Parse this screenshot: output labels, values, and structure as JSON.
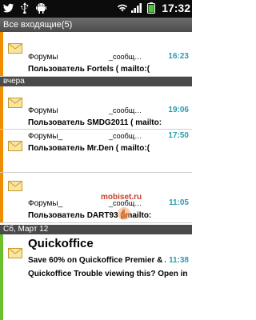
{
  "status": {
    "time": "17:32"
  },
  "header": {
    "title": "Все входящие(5)"
  },
  "sections": {
    "yesterday": "вчера",
    "saturday": "Сб, Март 12"
  },
  "emails": [
    {
      "sender": "Форумы",
      "mailto": "_сообщ…",
      "time": "16:23",
      "subject": "Пользователь Fortels ( mailto:(",
      "color": "#f08c00"
    },
    {
      "sender": "Форумы",
      "mailto": "_сообщ…",
      "time": "19:06",
      "subject": "Пользователь SMDG2011 ( mailto:",
      "color": "#f08c00"
    },
    {
      "sender": "Форумы_",
      "mailto": "_сообщ…",
      "time": "17:50",
      "subject": "Пользователь Mr.Den ( mailto:(",
      "color": "#f08c00"
    },
    {
      "sender": "Форумы_",
      "mailto": "_сообщ…",
      "time": "11:05",
      "subject": "Пользователь DART93 ( mailto:",
      "color": "#f08c00"
    }
  ],
  "quickoffice": {
    "title": "Quickoffice",
    "line1": "Save 60% on Quickoffice Premier & A…",
    "time": "11:38",
    "line2": "Quickoffice Trouble viewing this? Open in",
    "color": "#6abf2a"
  },
  "watermark": "mobiset.ru"
}
